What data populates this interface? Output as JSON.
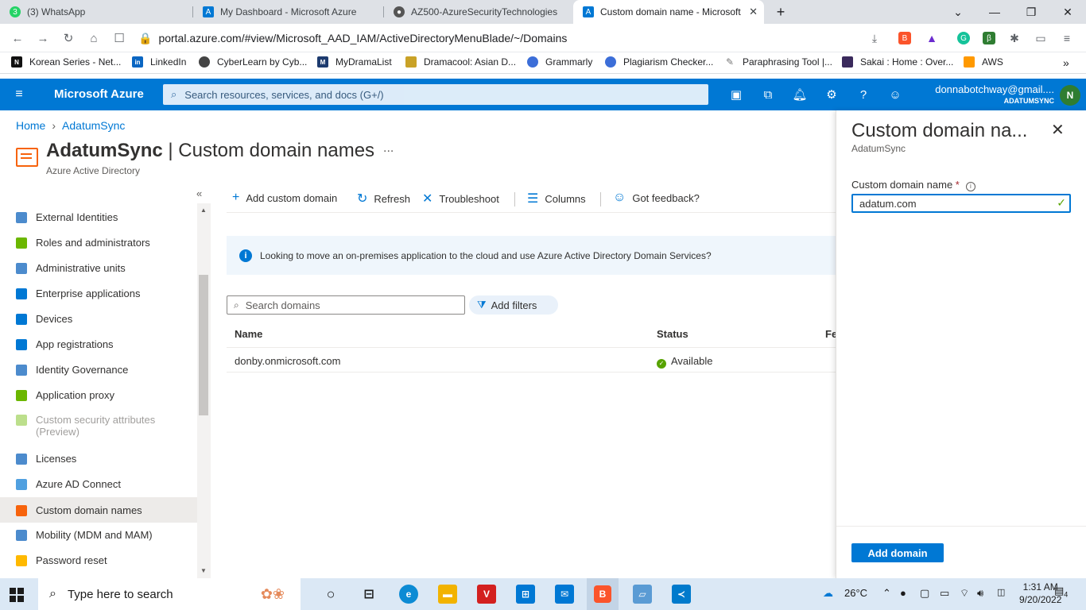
{
  "browser": {
    "tabs": [
      {
        "title": "(3) WhatsApp",
        "icon": "whatsapp-icon",
        "color": "#25d366"
      },
      {
        "title": "My Dashboard - Microsoft Azure",
        "icon": "azure-icon",
        "color": "#0078d4"
      },
      {
        "title": "AZ500-AzureSecurityTechnologies",
        "icon": "github-icon",
        "color": "#555555"
      },
      {
        "title": "Custom domain name - Microsoft",
        "icon": "azure-icon",
        "color": "#0078d4"
      }
    ],
    "url": "portal.azure.com/#view/Microsoft_AAD_IAM/ActiveDirectoryMenuBlade/~/Domains",
    "bookmarks": [
      {
        "label": "Korean Series - Net...",
        "color": "#111111"
      },
      {
        "label": "LinkedIn",
        "color": "#0a66c2"
      },
      {
        "label": "CyberLearn by Cyb...",
        "color": "#444444"
      },
      {
        "label": "MyDramaList",
        "color": "#1d3b6f"
      },
      {
        "label": "Dramacool: Asian D...",
        "color": "#c9a227"
      },
      {
        "label": "Grammarly",
        "color": "#15c39a"
      },
      {
        "label": "Plagiarism Checker...",
        "color": "#3c6ed8"
      },
      {
        "label": "Paraphrasing Tool |...",
        "color": "#777777"
      },
      {
        "label": "Sakai : Home : Over...",
        "color": "#3a2a5c"
      },
      {
        "label": "AWS",
        "color": "#ff9900"
      }
    ]
  },
  "azure": {
    "brand": "Microsoft Azure",
    "search_placeholder": "Search resources, services, and docs (G+/)",
    "user_email": "donnabotchway@gmail....",
    "tenant": "ADATUMSYNC",
    "avatar_initial": "N",
    "accent": "#0078d4"
  },
  "page": {
    "breadcrumb_home": "Home",
    "breadcrumb_current": "AdatumSync",
    "title_bold": "AdatumSync",
    "title_rest": " | Custom domain names",
    "subtitle": "Azure Active Directory",
    "more": "..."
  },
  "nav": [
    {
      "label": "External Identities",
      "color": "#4c8bcd"
    },
    {
      "label": "Roles and administrators",
      "color": "#6bb700"
    },
    {
      "label": "Administrative units",
      "color": "#4c8bcd"
    },
    {
      "label": "Enterprise applications",
      "color": "#0078d4"
    },
    {
      "label": "Devices",
      "color": "#0078d4"
    },
    {
      "label": "App registrations",
      "color": "#0078d4"
    },
    {
      "label": "Identity Governance",
      "color": "#4c8bcd"
    },
    {
      "label": "Application proxy",
      "color": "#6bb700"
    },
    {
      "label": "Custom security attributes (Preview)",
      "color": "#6bb700"
    },
    {
      "label": "Licenses",
      "color": "#4c8bcd"
    },
    {
      "label": "Azure AD Connect",
      "color": "#50a0e0"
    },
    {
      "label": "Custom domain names",
      "color": "#f7630c"
    },
    {
      "label": "Mobility (MDM and MAM)",
      "color": "#4c8bcd"
    },
    {
      "label": "Password reset",
      "color": "#ffb900"
    }
  ],
  "commands": {
    "add": "Add custom domain",
    "refresh": "Refresh",
    "troubleshoot": "Troubleshoot",
    "columns": "Columns",
    "feedback": "Got feedback?"
  },
  "info_text": "Looking to move an on-premises application to the cloud and use Azure Active Directory Domain Services?",
  "domain_search_placeholder": "Search domains",
  "add_filters": "Add filters",
  "table": {
    "headers": [
      "Name",
      "Status",
      "Fe"
    ],
    "rows": [
      {
        "name": "donby.onmicrosoft.com",
        "status": "Available"
      }
    ]
  },
  "panel": {
    "title": "Custom domain na...",
    "subtitle": "AdatumSync",
    "field_label": "Custom domain name",
    "required_mark": "*",
    "field_value": "adatum.com",
    "add_button": "Add domain"
  },
  "taskbar": {
    "search_placeholder": "Type here to search",
    "weather": "26°C",
    "time": "1:31 AM",
    "date": "9/20/2022",
    "notifications": "4"
  }
}
